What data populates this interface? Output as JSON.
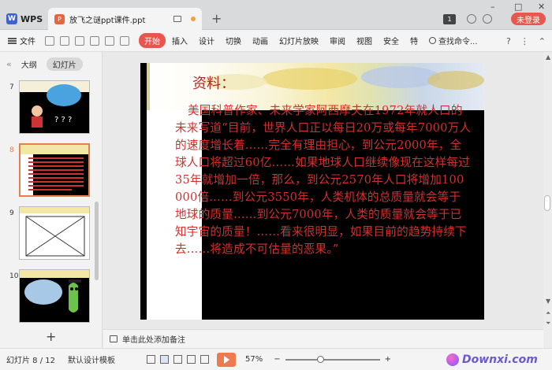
{
  "titlebar": {
    "app_tab": "WPS",
    "document_title": "放飞之谜ppt课件.ppt",
    "new_tab": "+",
    "min": "–",
    "max": "□",
    "close": "✕",
    "version_badge": "1",
    "login_label": "未登录"
  },
  "ribbon": {
    "file_menu": "文件",
    "tabs": [
      "开始",
      "插入",
      "设计",
      "切换",
      "动画",
      "幻灯片放映",
      "审阅",
      "视图",
      "安全",
      "特"
    ],
    "search_label": "查找命令...",
    "help": "?",
    "more": "⋮",
    "collapse": "⌃"
  },
  "left_panel": {
    "collapse": "«",
    "tab_outline": "大纲",
    "tab_slides": "幻灯片",
    "slide_numbers": [
      "7",
      "8",
      "9",
      "10"
    ],
    "add": "+"
  },
  "slide": {
    "heading": "资料：",
    "body": "美国科普作家、未来学家阿西摩夫在1972年就人口的未来写道“目前，世界人口正以每日20万或每年7000万人的速度增长着……完全有理由担心，到公元2000年，全球人口将超过60亿……如果地球人口继续像现在这样每过35年就增加一倍，那么，到公元2570年人口将增加100 000倍……到公元3550年，人类机体的总质量就会等于地球的质量……到公元7000年，人类的质量就会等于已知宇宙的质量！……看来很明显，如果目前的趋势持续下去……将造成不可估量的恶果。”"
  },
  "notes": {
    "placeholder": "单击此处添加备注"
  },
  "status": {
    "slide_counter": "幻灯片 8 / 12",
    "template": "默认设计模板",
    "zoom": "57%",
    "zoom_minus": "−",
    "zoom_plus": "+",
    "watermark": "Downxi.com"
  },
  "colors": {
    "accent": "#e9564d",
    "slide_text": "#d32f2f",
    "thumbnail_selected": "#e67e4d"
  }
}
